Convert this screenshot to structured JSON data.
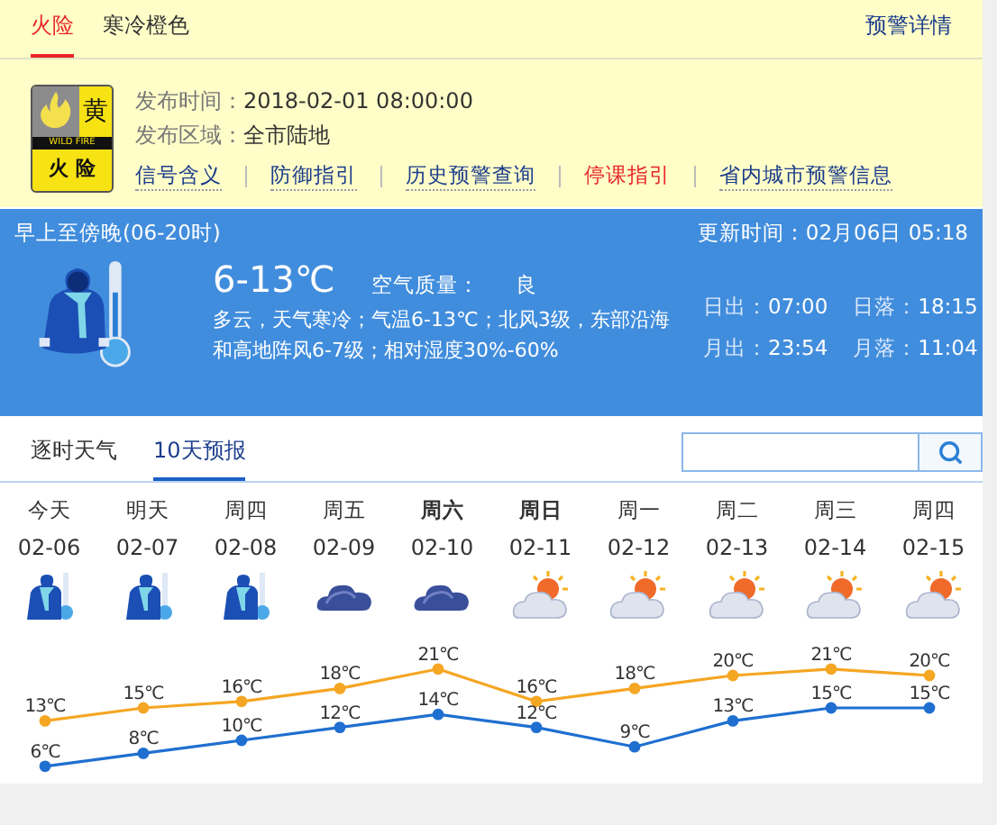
{
  "warning_tabs": [
    {
      "label": "火险",
      "selected": true
    },
    {
      "label": "寒冷橙色",
      "selected": false
    }
  ],
  "warning_details_link": "预警详情",
  "warning": {
    "badge": {
      "level": "黄",
      "band": "WILD FIRE",
      "name": "火 险"
    },
    "time_label": "发布时间：",
    "time": "2018-02-01 08:00:00",
    "area_label": "发布区域：",
    "area": "全市陆地",
    "links": [
      {
        "label": "信号含义",
        "highlighted": false
      },
      {
        "label": "防御指引",
        "highlighted": false
      },
      {
        "label": "历史预警查询",
        "highlighted": false
      },
      {
        "label": "停课指引",
        "highlighted": true
      },
      {
        "label": "省内城市预警信息",
        "highlighted": false
      }
    ]
  },
  "today": {
    "period": "早上至傍晚(06-20时)",
    "updated": "更新时间：02月06日 05:18",
    "temperature": "6-13℃",
    "air_label": "空气质量：",
    "air": "良",
    "description": "多云，天气寒冷；气温6-13℃；北风3级，东部沿海和高地阵风6-7级；相对湿度30%-60%",
    "sun_moon": [
      {
        "label": "日出：",
        "value": "07:00"
      },
      {
        "label": "日落：",
        "value": "18:15"
      },
      {
        "label": "月出：",
        "value": "23:54"
      },
      {
        "label": "月落：",
        "value": "11:04"
      }
    ]
  },
  "forecast_tabs": [
    {
      "label": "逐时天气",
      "selected": false
    },
    {
      "label": "10天预报",
      "selected": true
    }
  ],
  "days": [
    {
      "day": "今天",
      "date": "02-06",
      "weekend": false,
      "kind": "cold"
    },
    {
      "day": "明天",
      "date": "02-07",
      "weekend": false,
      "kind": "cold"
    },
    {
      "day": "周四",
      "date": "02-08",
      "weekend": false,
      "kind": "cold"
    },
    {
      "day": "周五",
      "date": "02-09",
      "weekend": false,
      "kind": "cloudy"
    },
    {
      "day": "周六",
      "date": "02-10",
      "weekend": true,
      "kind": "cloudy"
    },
    {
      "day": "周日",
      "date": "02-11",
      "weekend": true,
      "kind": "partly-cloudy"
    },
    {
      "day": "周一",
      "date": "02-12",
      "weekend": false,
      "kind": "partly-cloudy"
    },
    {
      "day": "周二",
      "date": "02-13",
      "weekend": false,
      "kind": "partly-cloudy"
    },
    {
      "day": "周三",
      "date": "02-14",
      "weekend": false,
      "kind": "partly-cloudy"
    },
    {
      "day": "周四",
      "date": "02-15",
      "weekend": false,
      "kind": "partly-cloudy"
    }
  ],
  "chart_data": {
    "type": "line",
    "data_labels": true,
    "series": [
      {
        "marker": true,
        "color": "#f5a623",
        "values": [
          13,
          15,
          16,
          18,
          21,
          16,
          18,
          20,
          21,
          20
        ],
        "value_labels": [
          "13℃",
          "15℃",
          "16℃",
          "18℃",
          "21℃",
          "16℃",
          "18℃",
          "20℃",
          "21℃",
          "20℃"
        ]
      },
      {
        "marker": true,
        "color": "#1f6fd0",
        "values": [
          6,
          8,
          10,
          12,
          14,
          12,
          9,
          13,
          15,
          15
        ],
        "value_labels": [
          "6℃",
          "8℃",
          "10℃",
          "12℃",
          "14℃",
          "12℃",
          "9℃",
          "13℃",
          "15℃",
          "15℃"
        ]
      }
    ]
  }
}
